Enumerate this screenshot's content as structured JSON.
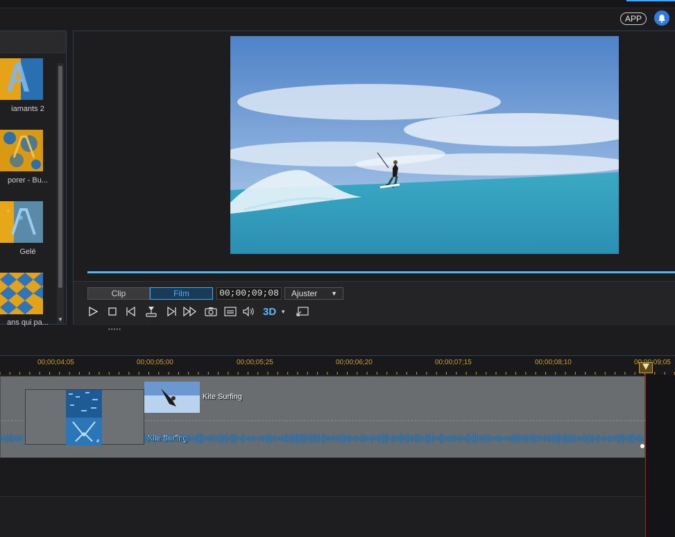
{
  "header": {
    "app_label": "APP",
    "icons": [
      "bell-icon"
    ]
  },
  "library": {
    "items": [
      {
        "label": "iamants 2"
      },
      {
        "label": "porer - Bu..."
      },
      {
        "label": "Gelé"
      },
      {
        "label": "ans qui pa..."
      }
    ]
  },
  "preview": {
    "tabs": {
      "clip": "Clip",
      "film": "Film"
    },
    "timecode": "00;00;09;08",
    "fit": "Ajuster",
    "controls": [
      "play-icon",
      "stop-icon",
      "prev-frame-icon",
      "split-icon",
      "next-frame-icon",
      "fast-forward-icon",
      "snapshot-icon",
      "subtitles-icon",
      "volume-icon",
      "3d-icon",
      "undock-icon"
    ],
    "three_d_label": "3D"
  },
  "timeline": {
    "ticks": [
      "00;00;04;05",
      "00;00;05;00",
      "00;00;05;25",
      "00;00;06;20",
      "00;00;07;15",
      "00;00;08;10",
      "00;00;09;05"
    ],
    "video_clip_label": "Kite Surfing",
    "audio_clip_label": "Kite Surfing",
    "colors": {
      "tick": "#c9a227",
      "playline": "#c0202a",
      "wave": "#2a6ea8"
    }
  }
}
